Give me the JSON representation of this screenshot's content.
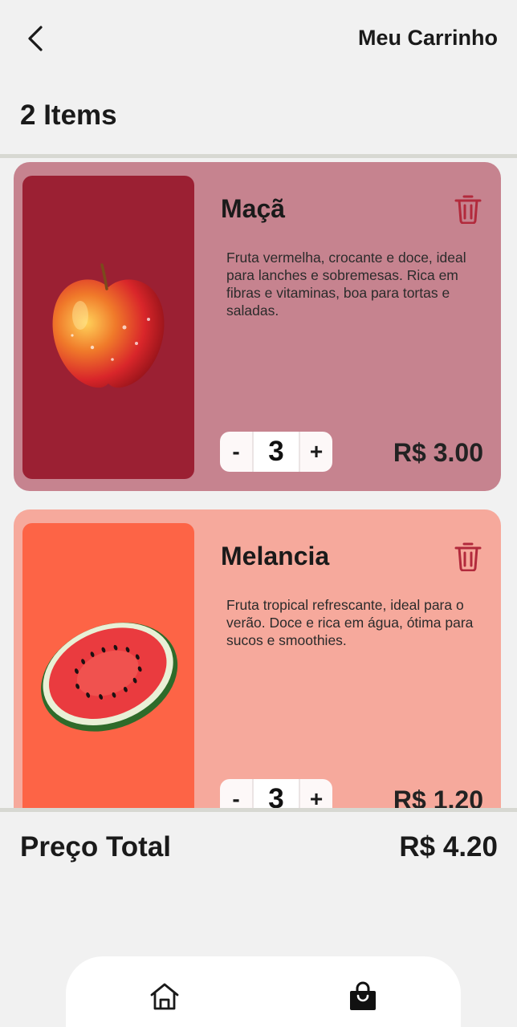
{
  "header": {
    "title": "Meu Carrinho",
    "back_icon": "chevron-left-icon"
  },
  "cart": {
    "items_count_label": "2 Items",
    "items": [
      {
        "name": "Maçã",
        "description": "Fruta vermelha, crocante e doce, ideal para lanches e sobremesas. Rica em fibras e vitaminas, boa para tortas e saladas.",
        "quantity": "3",
        "price": "R$ 3.00",
        "minus_label": "-",
        "plus_label": "+",
        "card_color": "#c6838f",
        "image_bg": "#9b2033",
        "image": "apple"
      },
      {
        "name": "Melancia",
        "description": "Fruta tropical refrescante, ideal para o verão. Doce e rica em água, ótima para sucos e smoothies.",
        "quantity": "3",
        "price": "R$ 1.20",
        "minus_label": "-",
        "plus_label": "+",
        "card_color": "#f6a99c",
        "image_bg": "#fd6446",
        "image": "watermelon"
      }
    ]
  },
  "summary": {
    "total_label": "Preço Total",
    "total_value": "R$ 4.20"
  },
  "nav": {
    "items": [
      {
        "icon": "home-icon",
        "active": false
      },
      {
        "icon": "shopping-bag-icon",
        "active": true
      }
    ]
  },
  "colors": {
    "background": "#f1f1f1",
    "accent_trash": "#b22a3c",
    "divider": "#d7d8d2"
  }
}
